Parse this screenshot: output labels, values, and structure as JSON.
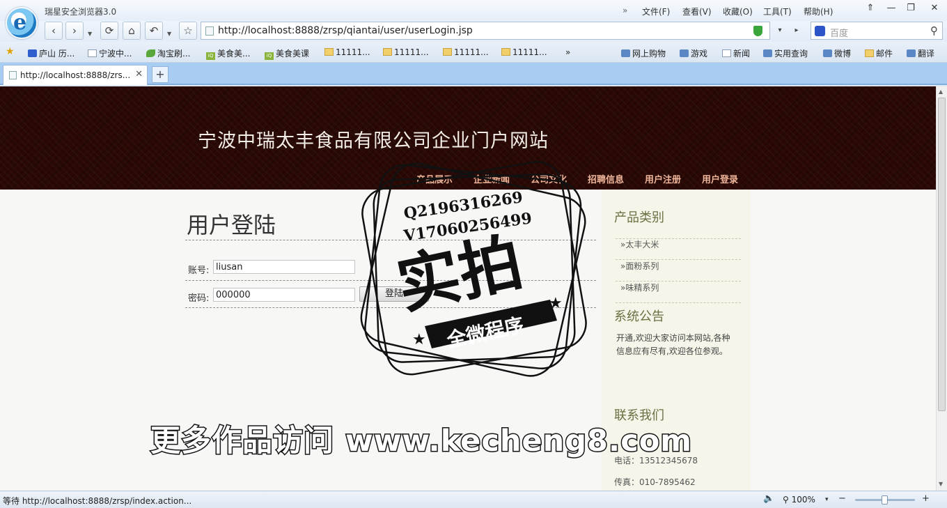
{
  "window": {
    "app_title": "瑞星安全浏览器3.0",
    "menu_chevron": "»",
    "menu": [
      "文件(F)",
      "查看(V)",
      "收藏(O)",
      "工具(T)",
      "帮助(H)"
    ],
    "controls": {
      "pin": "⇑",
      "minimize": "—",
      "restore": "❐",
      "close": "✕"
    }
  },
  "nav": {
    "back": "‹",
    "forward": "›",
    "refresh": "⟳",
    "home": "⌂",
    "undo": "↶",
    "star": "☆",
    "url": "http://localhost:8888/zrsp/qiantai/user/userLogin.jsp",
    "addr_drop": "▾",
    "addr_go": "▸",
    "search_placeholder": "百度",
    "search_icon": "⚲"
  },
  "favorites": {
    "star": "★",
    "items": [
      "庐山 历...",
      "宁波中...",
      "淘宝刷...",
      "美食美...",
      "美食美课",
      "11111...",
      "11111...",
      "11111...",
      "11111..."
    ],
    "more": "»",
    "right_items": [
      "网上购物",
      "游戏",
      "新闻",
      "实用查询",
      "微博",
      "邮件",
      "翻译"
    ]
  },
  "tabs": {
    "active_label": "http://localhost:8888/zrs...",
    "close": "✕",
    "new_tab": "+"
  },
  "site": {
    "title": "宁波中瑞太丰食品有限公司企业门户网站",
    "nav": [
      "产品展示",
      "企业新闻",
      "公司文化",
      "招聘信息",
      "用户注册",
      "用户登录"
    ]
  },
  "login": {
    "heading": "用户登陆",
    "account_label": "账号:",
    "account_value": "liusan",
    "password_label": "密码:",
    "password_value": "000000",
    "submit": "登陆"
  },
  "sidebar": {
    "categories_title": "产品类别",
    "categories": [
      "»太丰大米",
      "»面粉系列",
      "»味精系列"
    ],
    "notice_title": "系统公告",
    "notice_text": "开通,欢迎大家访问本网站,各种信息应有尽有,欢迎各位参观。",
    "contact_title": "联系我们",
    "contact": [
      "电话：13512345678",
      "传真：010-7895462"
    ]
  },
  "watermark": {
    "line1": "Q2196316269",
    "line2": "V17060256499",
    "big": "实拍",
    "banner": "全微程序",
    "promo": "更多作品访问 www.kecheng8.com"
  },
  "status": {
    "text": "等待 http://localhost:8888/zrsp/index.action...",
    "sound": "🔈",
    "zoom": "100%",
    "zoom_drop": "▾",
    "zoom_minus": "−",
    "zoom_plus": "+"
  }
}
